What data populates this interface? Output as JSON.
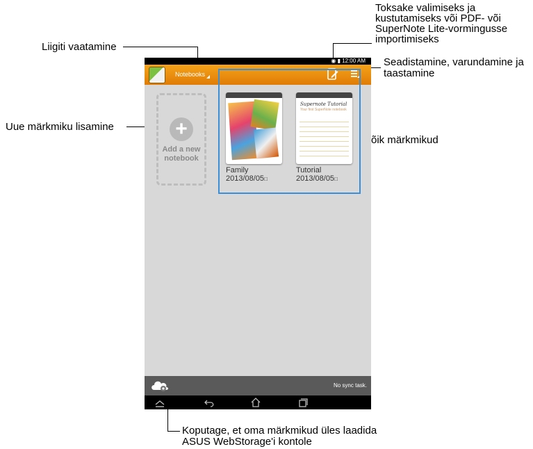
{
  "callouts": {
    "view_by_type": "Liigiti vaatamine",
    "tap_select": [
      "Toksake valimiseks ja",
      "kustutamiseks või PDF- või",
      "SuperNote Lite-vormingusse",
      "importimiseks"
    ],
    "settings": [
      "Seadistamine, varundamine ja",
      "taastamine"
    ],
    "add_notebook": "Uue märkmiku lisamine",
    "all_notebooks": "Kõik märkmikud",
    "upload": [
      "Koputage, et oma märkmikud üles laadida",
      "ASUS WebStorage'i kontole"
    ]
  },
  "status_bar": {
    "time": "12:00 AM"
  },
  "action_bar": {
    "dropdown_label": "Notebooks"
  },
  "add_card": {
    "line1": "Add a new",
    "line2": "notebook"
  },
  "notebooks": [
    {
      "title": "Family",
      "date": "2013/08/05"
    },
    {
      "title": "Tutorial",
      "date": "2013/08/05",
      "cover_title": "Supernote Tutorial",
      "cover_subtitle": "Your first SuperNote notebook"
    }
  ],
  "bottom_bar": {
    "sync_status": "No sync task."
  },
  "colors": {
    "action_bar": "#e8890c",
    "selection": "#3a8fd8",
    "screen_bg": "#d8d8d8"
  },
  "icons": [
    "app-icon",
    "edit-select-icon",
    "menu-icon",
    "plus-icon",
    "cloud-sync-icon",
    "nav-home-up-icon",
    "nav-back-icon",
    "nav-home-icon",
    "nav-recent-icon"
  ]
}
